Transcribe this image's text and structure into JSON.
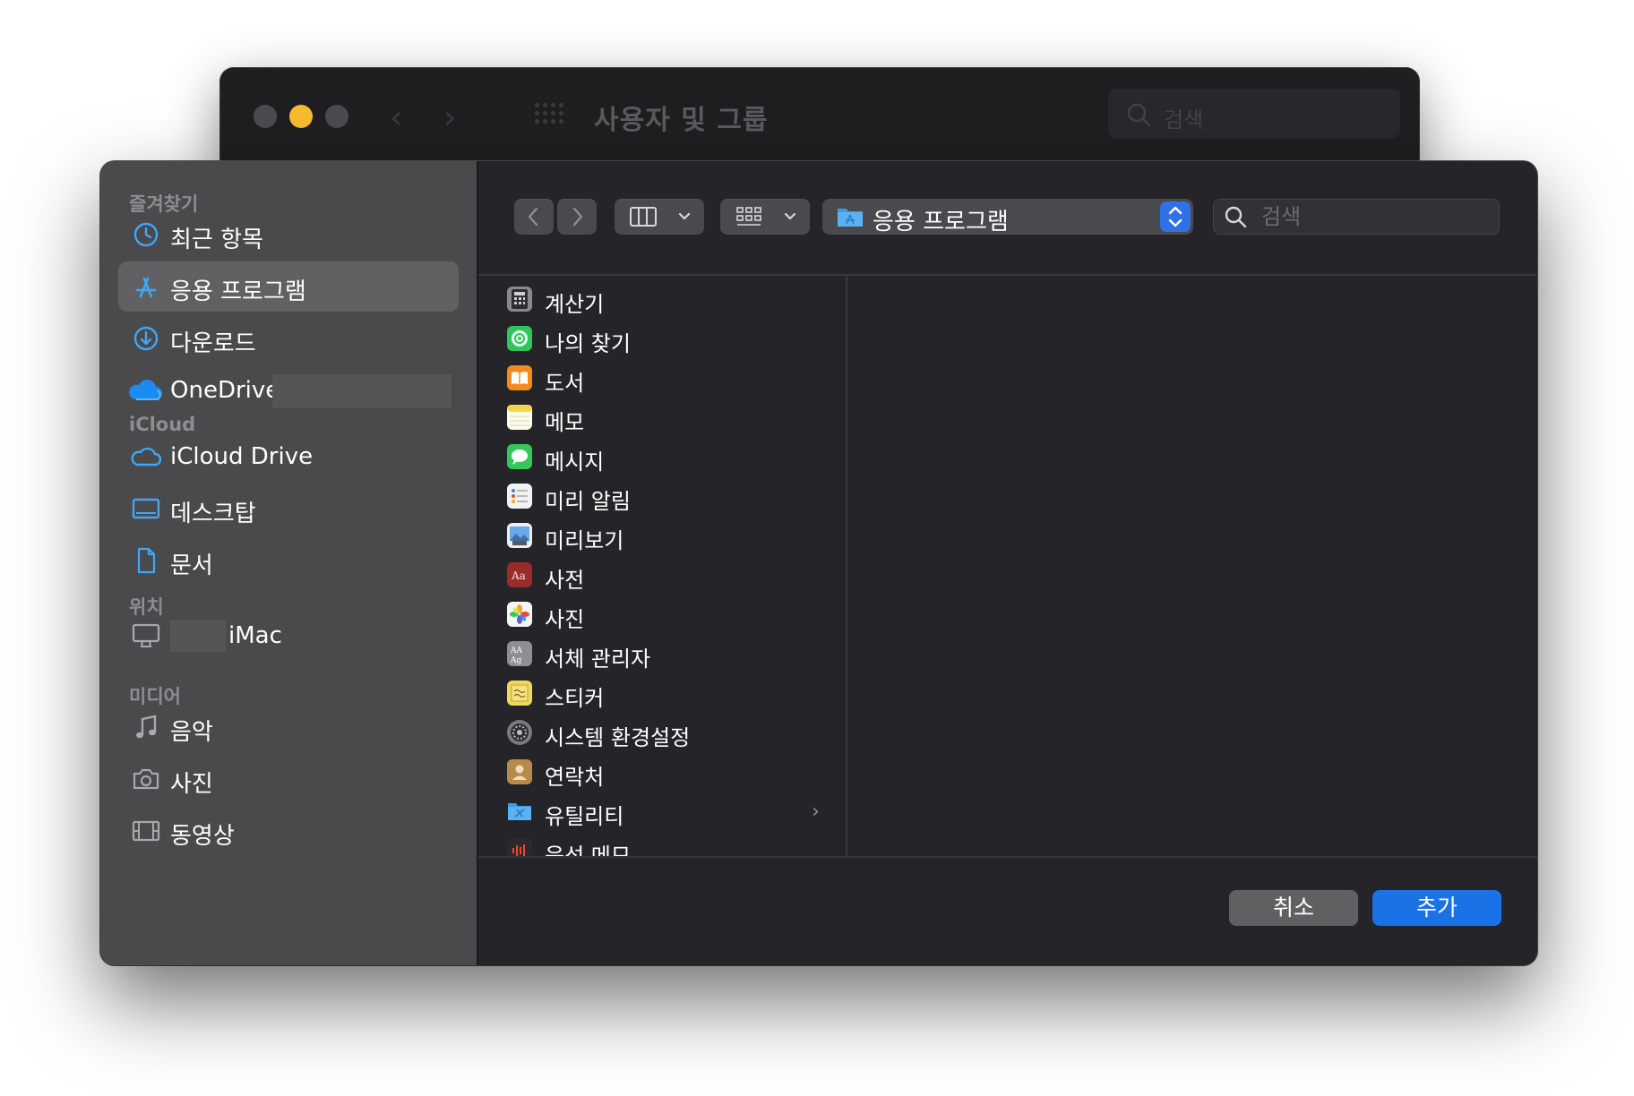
{
  "background_window": {
    "title": "사용자 및 그룹",
    "search_placeholder": "검색"
  },
  "sidebar": {
    "sections": [
      {
        "title": "즐겨찾기"
      },
      {
        "title": "iCloud"
      },
      {
        "title": "위치"
      },
      {
        "title": "미디어"
      }
    ],
    "favorites": [
      {
        "label": "최근 항목",
        "icon": "clock-icon"
      },
      {
        "label": "응용 프로그램",
        "icon": "app-store-icon",
        "selected": true
      },
      {
        "label": "다운로드",
        "icon": "download-icon"
      },
      {
        "label": "OneDrive -",
        "icon": "onedrive-cloud-icon"
      }
    ],
    "icloud": [
      {
        "label": "iCloud Drive",
        "icon": "cloud-icon"
      },
      {
        "label": "데스크탑",
        "icon": "desktop-icon"
      },
      {
        "label": "문서",
        "icon": "document-icon"
      }
    ],
    "locations": [
      {
        "label": "iMac",
        "icon": "imac-icon"
      }
    ],
    "media": [
      {
        "label": "음악",
        "icon": "music-note-icon"
      },
      {
        "label": "사진",
        "icon": "camera-icon"
      },
      {
        "label": "동영상",
        "icon": "film-icon"
      }
    ]
  },
  "toolbar": {
    "path_label": "응용 프로그램",
    "search_placeholder": "검색"
  },
  "files": [
    {
      "name": "계산기",
      "icon": "calculator-icon",
      "color": "#8a8a8e"
    },
    {
      "name": "나의 찾기",
      "icon": "find-my-icon",
      "color": "#30c45c"
    },
    {
      "name": "도서",
      "icon": "books-icon",
      "color": "#f28a1c"
    },
    {
      "name": "메모",
      "icon": "notes-icon",
      "color": "#f7d54a"
    },
    {
      "name": "메시지",
      "icon": "messages-icon",
      "color": "#34c759"
    },
    {
      "name": "미리 알림",
      "icon": "reminders-icon",
      "color": "#f2f2f2"
    },
    {
      "name": "미리보기",
      "icon": "preview-icon",
      "color": "#6aa8e6"
    },
    {
      "name": "사전",
      "icon": "dictionary-icon",
      "color": "#9a2b2b"
    },
    {
      "name": "사진",
      "icon": "photos-icon",
      "color": "#f5f5f5"
    },
    {
      "name": "서체 관리자",
      "icon": "font-book-icon",
      "color": "#8e8e93"
    },
    {
      "name": "스티커",
      "icon": "stickies-icon",
      "color": "#f0d860"
    },
    {
      "name": "시스템 환경설정",
      "icon": "system-preferences-icon",
      "color": "#7c7c80"
    },
    {
      "name": "연락처",
      "icon": "contacts-icon",
      "color": "#b88a4a"
    },
    {
      "name": "유틸리티",
      "icon": "utilities-folder-icon",
      "color": "#4aa8e8",
      "has_children": true
    },
    {
      "name": "음성 메모",
      "icon": "voice-memos-icon",
      "color": "#2a2a2e"
    }
  ],
  "buttons": {
    "cancel": "취소",
    "add": "추가"
  },
  "colors": {
    "accent": "#1b72e6",
    "traffic_minimize": "#f7bd2e"
  }
}
